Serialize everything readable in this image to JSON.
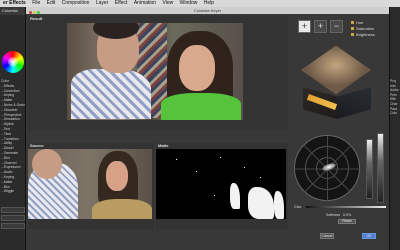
{
  "menubar": {
    "app": "er Effects",
    "items": [
      "File",
      "Edit",
      "Composition",
      "Layer",
      "Effect",
      "Animation",
      "View",
      "Window",
      "Help"
    ]
  },
  "window": {
    "title": "Colorista Keyer"
  },
  "left_panel": {
    "header": "Colorista",
    "effects": [
      "Color",
      "...Effects",
      "...Correction",
      "...Keying",
      "...Matte",
      "...Noise & Grain",
      "...Obsolete",
      "...Perspective",
      "...Simulation",
      "...Stylize",
      "...Text",
      "...Time",
      "...Transition",
      "...Utility",
      "...Distort",
      "...Generate",
      "...Blur",
      "...Channel",
      "...Expression",
      "...Audio",
      "...Keying",
      "...Matte",
      "...Blur",
      "...Wiggle"
    ]
  },
  "viewers": {
    "result_label": "Result",
    "source_label": "Source",
    "matte_label": "Matte"
  },
  "tools": {
    "add": "+",
    "subtract": "−",
    "pick": "+"
  },
  "checks": {
    "items": [
      "Hue",
      "Saturation",
      "Brightness"
    ]
  },
  "controls": {
    "choke_label": "Cho",
    "softness_label": "Softness",
    "softness_value": "0.0%",
    "reset_label": "Reset",
    "cancel_label": "Cancel",
    "ok_label": "OK"
  },
  "right_panel": {
    "items": [
      "Proj",
      "Info",
      "Audio",
      "Prev",
      "Effe",
      "Char",
      "Para",
      "Colo"
    ]
  }
}
